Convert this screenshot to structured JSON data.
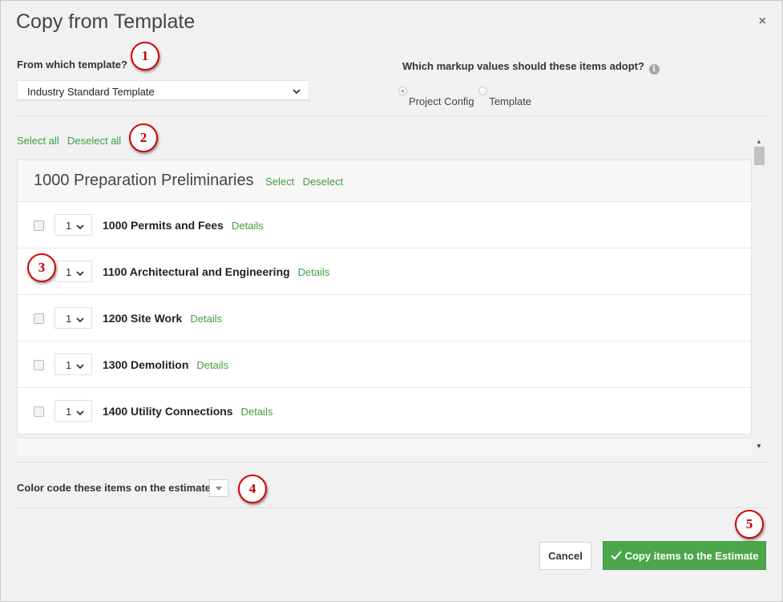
{
  "dialog": {
    "title": "Copy from Template",
    "close_glyph": "×"
  },
  "template_section": {
    "label": "From which template?",
    "selected": "Industry Standard Template"
  },
  "markup_section": {
    "label": "Which markup values should these items adopt?",
    "info_glyph": "i",
    "options": [
      {
        "label": "Project Config",
        "checked": true
      },
      {
        "label": "Template",
        "checked": false
      }
    ]
  },
  "selection": {
    "select_all": "Select all",
    "deselect_all": "Deselect all"
  },
  "group": {
    "title": "1000 Preparation Preliminaries",
    "select": "Select",
    "deselect": "Deselect",
    "items": [
      {
        "qty": "1",
        "name": "1000 Permits and Fees",
        "details": "Details"
      },
      {
        "qty": "1",
        "name": "1100 Architectural and Engineering",
        "details": "Details"
      },
      {
        "qty": "1",
        "name": "1200 Site Work",
        "details": "Details"
      },
      {
        "qty": "1",
        "name": "1300 Demolition",
        "details": "Details"
      },
      {
        "qty": "1",
        "name": "1400 Utility Connections",
        "details": "Details"
      }
    ]
  },
  "color_code": {
    "label": "Color code these items on the estimate?"
  },
  "buttons": {
    "cancel": "Cancel",
    "copy": "Copy items to the Estimate"
  },
  "annotations": [
    "1",
    "2",
    "3",
    "4",
    "5"
  ],
  "colors": {
    "accent_green": "#4ca64c",
    "link_green": "#3f9e3f",
    "annotation_red": "#d40000"
  }
}
